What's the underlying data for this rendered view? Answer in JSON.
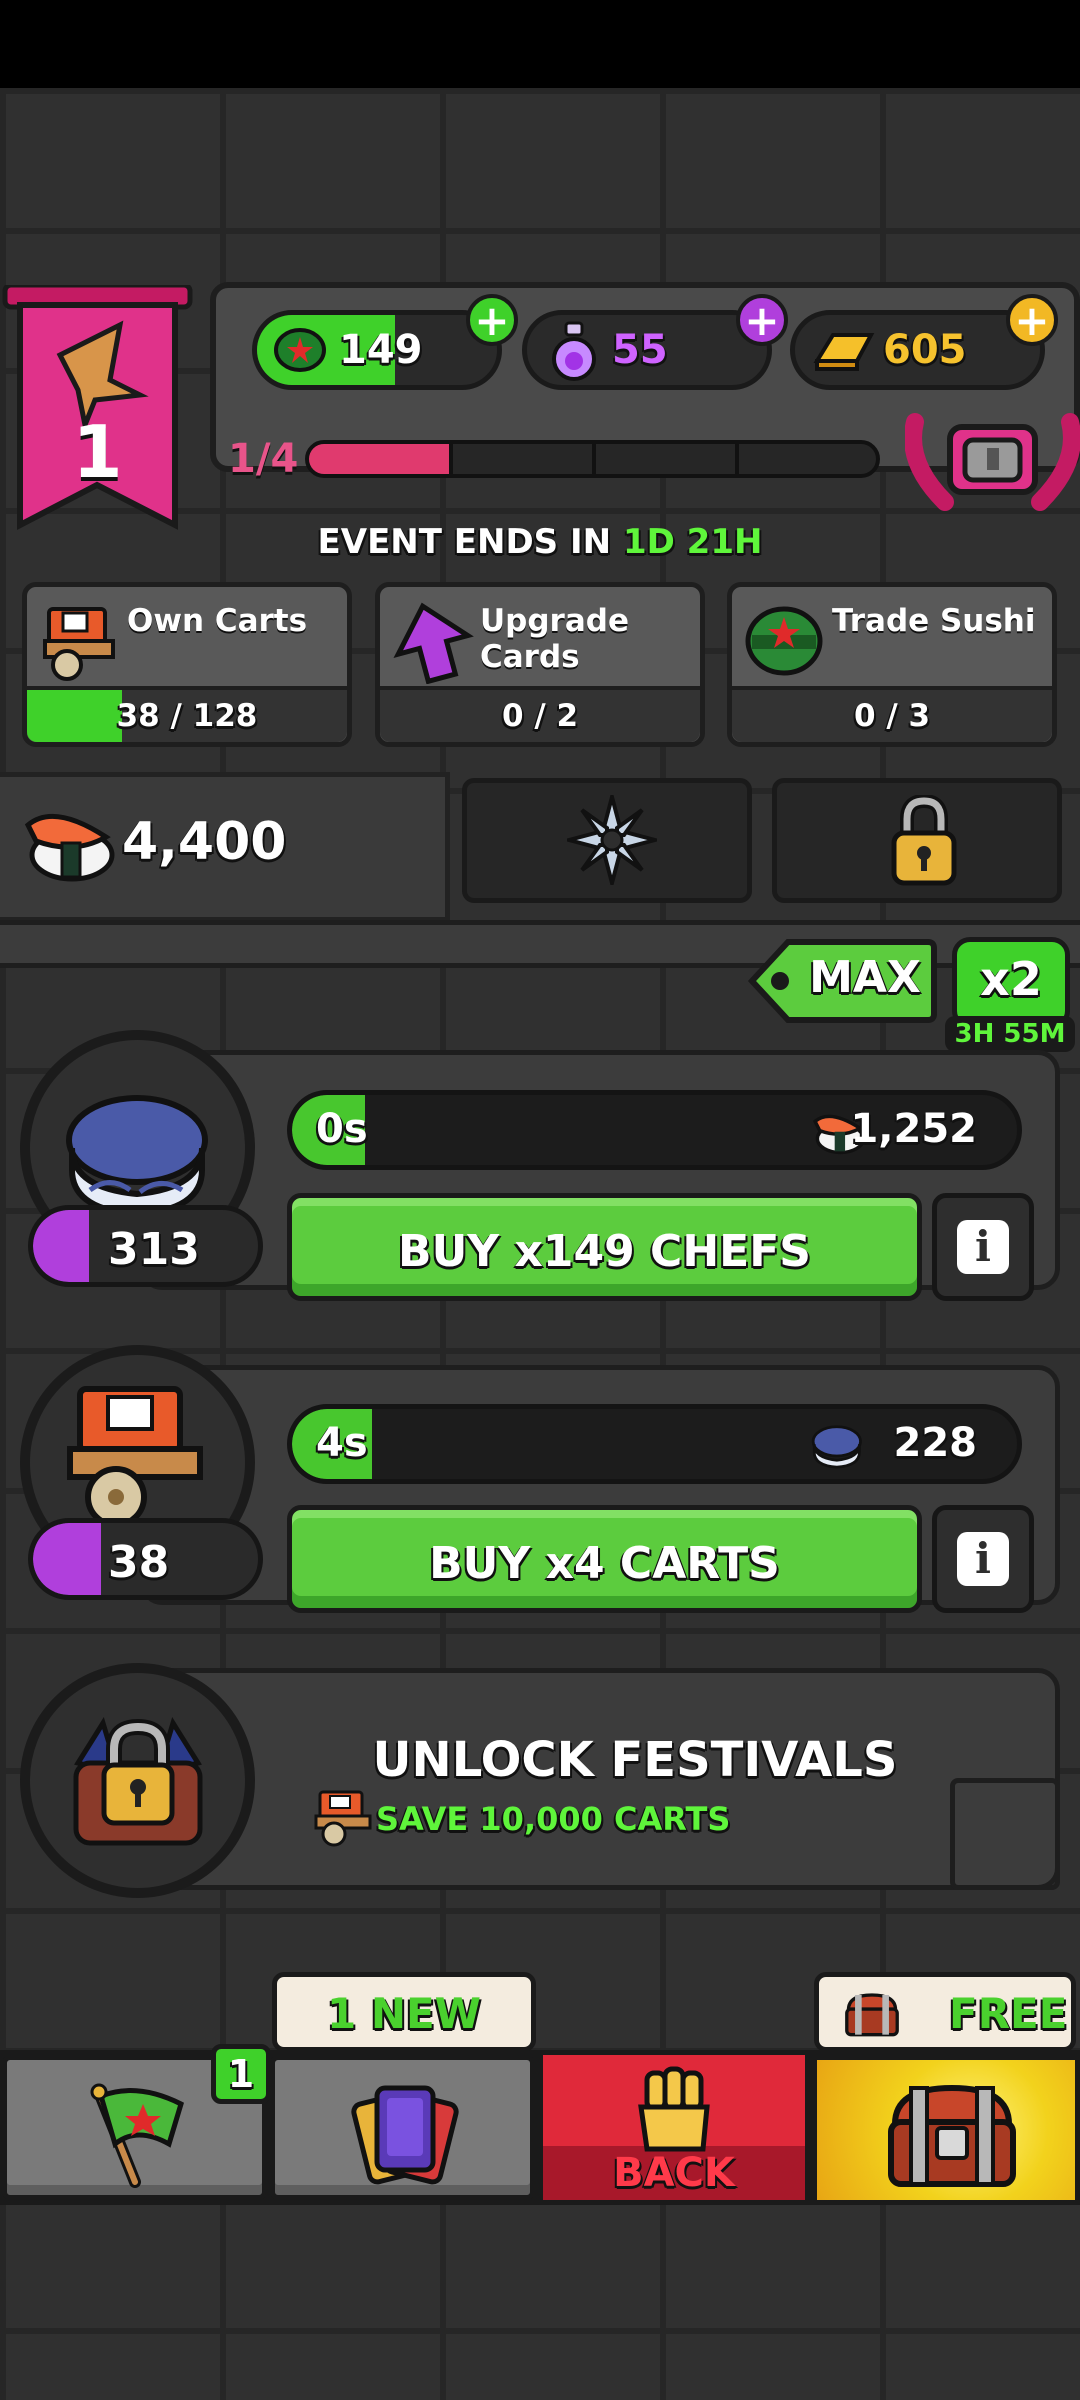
{
  "header": {
    "player_level": "1",
    "currencies": [
      {
        "name": "tickets",
        "value": "149",
        "color": "#3fd12a"
      },
      {
        "name": "potions",
        "value": "55",
        "color": "#b03fdc"
      },
      {
        "name": "gold",
        "value": "605",
        "color": "#f2b824"
      }
    ],
    "level_progress_label": "1/4",
    "level_progress_fraction": 0.25
  },
  "event": {
    "prefix": "EVENT ENDS IN",
    "time": "1D 21H"
  },
  "quests": [
    {
      "title_line1": "Own Carts",
      "title_line2": "",
      "progress": "38 / 128",
      "fraction": 0.297,
      "icon": "food-cart-icon"
    },
    {
      "title_line1": "Upgrade",
      "title_line2": "Cards",
      "progress": "0 / 2",
      "fraction": 0,
      "icon": "upgrade-arrow-icon"
    },
    {
      "title_line1": "Trade Sushi",
      "title_line2": "",
      "progress": "0 / 3",
      "fraction": 0,
      "icon": "ninja-head-icon"
    }
  ],
  "score": {
    "value": "4,400",
    "icon": "sushi-icon"
  },
  "multiplier": {
    "max_label": "MAX",
    "x2_label": "x2",
    "x2_timer": "3H 55M"
  },
  "producers": [
    {
      "icon": "chef-hat-icon",
      "level": "313",
      "level_fraction": 0.25,
      "timer": "0s",
      "timer_fraction": 0.1,
      "yield_value": "1,252",
      "yield_icon": "sushi-icon",
      "buy_label": "BUY x149 CHEFS"
    },
    {
      "icon": "food-cart-icon",
      "level": "38",
      "level_fraction": 0.3,
      "timer": "4s",
      "timer_fraction": 0.11,
      "yield_value": "228",
      "yield_icon": "chef-hat-icon",
      "buy_label": "BUY x4 CARTS"
    }
  ],
  "unlock": {
    "title": "UNLOCK FESTIVALS",
    "subtitle": "SAVE 10,000 CARTS",
    "icon": "locked-festival-icon"
  },
  "nav": {
    "flag_badge": "1",
    "cards_tag": "1 NEW",
    "back_label": "BACK",
    "free_tag": "FREE"
  }
}
